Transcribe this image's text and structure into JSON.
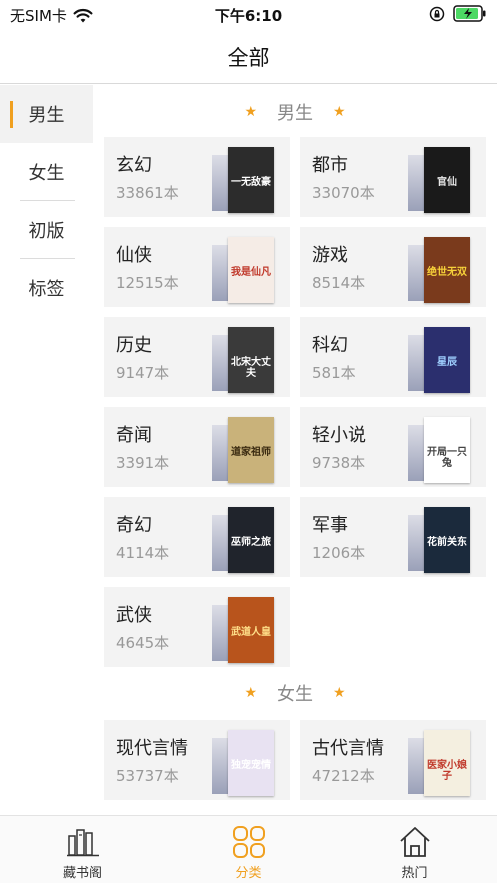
{
  "status_bar": {
    "carrier": "无SIM卡",
    "time": "下午6:10"
  },
  "nav": {
    "title": "全部"
  },
  "sidebar": {
    "items": [
      {
        "label": "男生",
        "active": true
      },
      {
        "label": "女生",
        "active": false
      },
      {
        "label": "初版",
        "active": false
      },
      {
        "label": "标签",
        "active": false
      }
    ]
  },
  "sections": {
    "male": {
      "title": "男生",
      "items": [
        {
          "name": "玄幻",
          "count": "33861本",
          "cover_text": "一无敌豪",
          "cover_color": "#2c2c2c",
          "text_color": "#ffffff"
        },
        {
          "name": "都市",
          "count": "33070本",
          "cover_text": "官仙",
          "cover_color": "#1a1a1a",
          "text_color": "#e8e8e8"
        },
        {
          "name": "仙侠",
          "count": "12515本",
          "cover_text": "我是仙凡",
          "cover_color": "#f5ece6",
          "text_color": "#c0392b"
        },
        {
          "name": "游戏",
          "count": "8514本",
          "cover_text": "绝世无双",
          "cover_color": "#7a3a1c",
          "text_color": "#f7d23a"
        },
        {
          "name": "历史",
          "count": "9147本",
          "cover_text": "北宋大丈夫",
          "cover_color": "#3a3a3a",
          "text_color": "#ffffff"
        },
        {
          "name": "科幻",
          "count": "581本",
          "cover_text": "星辰",
          "cover_color": "#2b2f6e",
          "text_color": "#9fd0ff"
        },
        {
          "name": "奇闻",
          "count": "3391本",
          "cover_text": "道家祖师",
          "cover_color": "#c9b27a",
          "text_color": "#3a2a10"
        },
        {
          "name": "轻小说",
          "count": "9738本",
          "cover_text": "开局一只兔",
          "cover_color": "#ffffff",
          "text_color": "#444444"
        },
        {
          "name": "奇幻",
          "count": "4114本",
          "cover_text": "巫师之旅",
          "cover_color": "#20242c",
          "text_color": "#ffffff"
        },
        {
          "name": "军事",
          "count": "1206本",
          "cover_text": "花前关东",
          "cover_color": "#1b2a3c",
          "text_color": "#ffffff"
        },
        {
          "name": "武侠",
          "count": "4645本",
          "cover_text": "武道人皇",
          "cover_color": "#b8541c",
          "text_color": "#ffe08a"
        }
      ]
    },
    "female": {
      "title": "女生",
      "items": [
        {
          "name": "现代言情",
          "count": "53737本",
          "cover_text": "独宠宠情",
          "cover_color": "#e8e2f2",
          "text_color": "#ffffff"
        },
        {
          "name": "古代言情",
          "count": "47212本",
          "cover_text": "医家小娘子",
          "cover_color": "#f4efe0",
          "text_color": "#c0392b"
        }
      ]
    }
  },
  "tabbar": {
    "items": [
      {
        "label": "藏书阁",
        "icon": "bookshelf-icon",
        "active": false
      },
      {
        "label": "分类",
        "icon": "grid-icon",
        "active": true
      },
      {
        "label": "热门",
        "icon": "home-icon",
        "active": false
      }
    ]
  },
  "colors": {
    "accent": "#f0a020",
    "card_bg": "#f3f3f3"
  }
}
